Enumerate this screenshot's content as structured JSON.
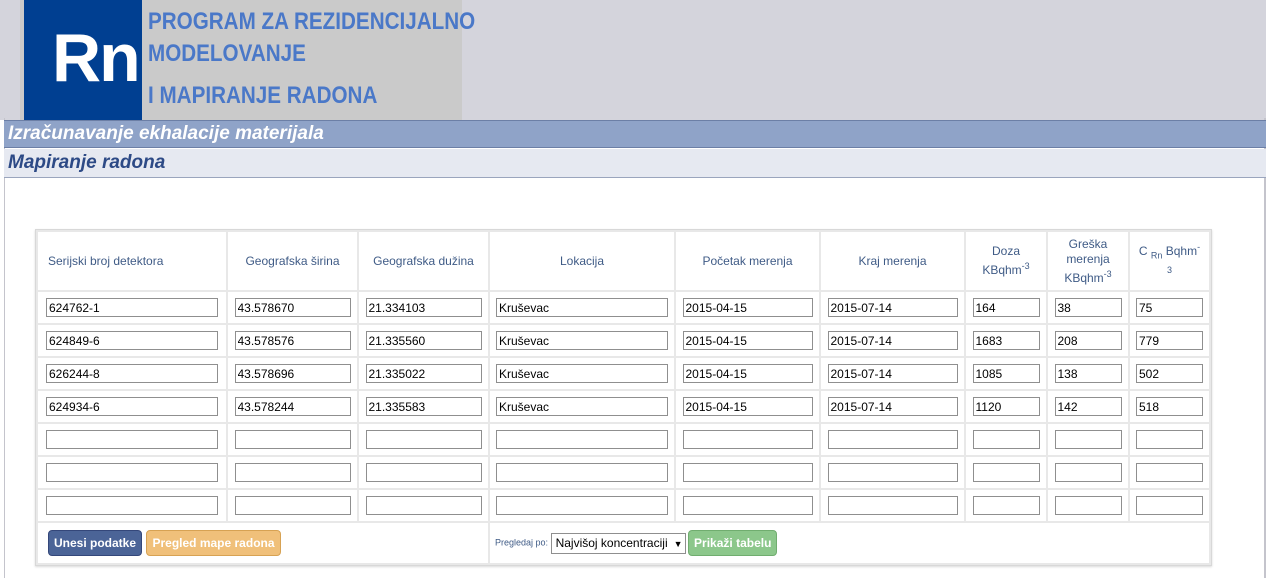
{
  "logo": {
    "abbr": "Rn",
    "title_line1": "PROGRAM ZA REZIDENCIJALNO",
    "title_line2": "MODELOVANJE",
    "title_line3": "I MAPIRANJE RADONA"
  },
  "menu": {
    "item1": "Izračunavanje ekhalacije materijala",
    "item2": "Mapiranje radona"
  },
  "table": {
    "headers": {
      "serial": "Serijski broj detektora",
      "lat": "Geografska širina",
      "lon": "Geografska dužina",
      "location": "Lokacija",
      "start": "Početak merenja",
      "end": "Kraj merenja",
      "dose": "Doza",
      "dose_unit": "KBqhm",
      "dose_exp": "-3",
      "error_l1": "Greška",
      "error_l2": "merenja",
      "error_unit": "KBqhm",
      "error_exp": "-3",
      "conc_c": "C",
      "conc_sub": "Rn",
      "conc_unit": "Bqhm",
      "conc_exp1": "-",
      "conc_exp2": "3"
    },
    "rows": [
      {
        "serial": "624762-1",
        "lat": "43.578670",
        "lon": "21.334103",
        "location": "Kruševac",
        "start": "2015-04-15",
        "end": "2015-07-14",
        "dose": "164",
        "error": "38",
        "conc": "75"
      },
      {
        "serial": "624849-6",
        "lat": "43.578576",
        "lon": "21.335560",
        "location": "Kruševac",
        "start": "2015-04-15",
        "end": "2015-07-14",
        "dose": "1683",
        "error": "208",
        "conc": "779"
      },
      {
        "serial": "626244-8",
        "lat": "43.578696",
        "lon": "21.335022",
        "location": "Kruševac",
        "start": "2015-04-15",
        "end": "2015-07-14",
        "dose": "1085",
        "error": "138",
        "conc": "502"
      },
      {
        "serial": "624934-6",
        "lat": "43.578244",
        "lon": "21.335583",
        "location": "Kruševac",
        "start": "2015-04-15",
        "end": "2015-07-14",
        "dose": "1120",
        "error": "142",
        "conc": "518"
      },
      {
        "serial": "",
        "lat": "",
        "lon": "",
        "location": "",
        "start": "",
        "end": "",
        "dose": "",
        "error": "",
        "conc": ""
      },
      {
        "serial": "",
        "lat": "",
        "lon": "",
        "location": "",
        "start": "",
        "end": "",
        "dose": "",
        "error": "",
        "conc": ""
      },
      {
        "serial": "",
        "lat": "",
        "lon": "",
        "location": "",
        "start": "",
        "end": "",
        "dose": "",
        "error": "",
        "conc": ""
      }
    ]
  },
  "actions": {
    "submit_label": "Unesi podatke",
    "map_label": "Pregled mape radona",
    "view_by_label": "Pregledaj po:",
    "sort_selected": "Najvišoj koncentraciji",
    "show_table_label": "Prikaži tabelu"
  },
  "colors": {
    "logo_blue": "#003f91",
    "title_blue": "#4a78c8",
    "menu_bar": "#8fa3c8",
    "button_blue": "#4b6497",
    "button_orange": "#f0c07a",
    "button_green": "#8cc78b"
  }
}
